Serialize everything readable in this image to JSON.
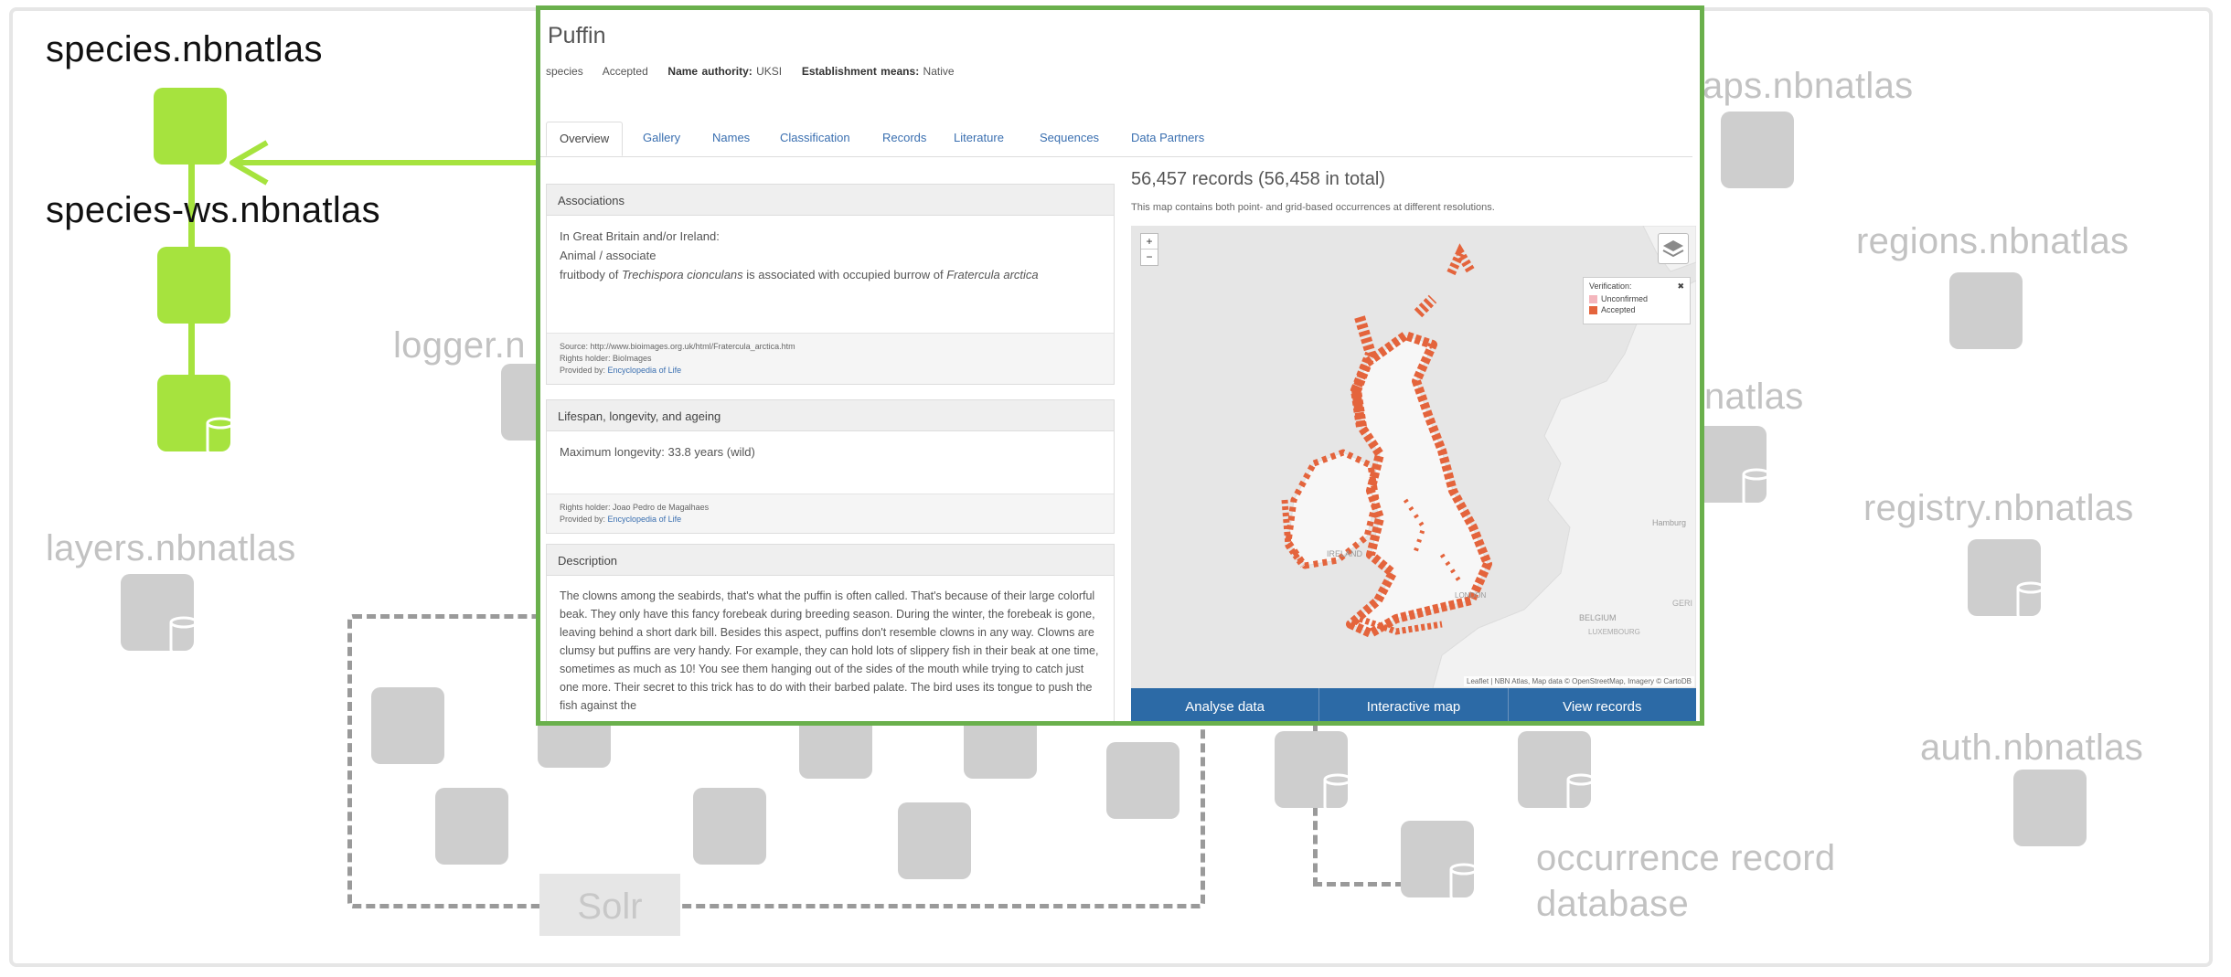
{
  "diagram": {
    "labels": {
      "species": "species.nbnatlas",
      "species_ws": "species-ws.nbnatlas",
      "logger": "logger.n",
      "layers": "layers.nbnatlas",
      "maps": "aps.nbnatlas",
      "regions": "regions.nbnatlas",
      "natlas": "natlas",
      "registry": "registry.nbnatlas",
      "auth": "auth.nbnatlas",
      "occurrence_line1": "occurrence record",
      "occurrence_line2": "database",
      "solr": "Solr"
    },
    "colors": {
      "highlight": "#a6e33e",
      "node": "#cecece",
      "panel_border": "#6ab04c"
    }
  },
  "species_page": {
    "title": "Puffin",
    "meta": {
      "rank": "species",
      "status": "Accepted",
      "name_authority_label": "Name authority:",
      "name_authority": "UKSI",
      "establishment_label": "Establishment means:",
      "establishment": "Native"
    },
    "tabs": [
      "Overview",
      "Gallery",
      "Names",
      "Classification",
      "Records",
      "Literature",
      "Sequences",
      "Data Partners"
    ],
    "associations": {
      "heading": "Associations",
      "line1": "In Great Britain and/or Ireland:",
      "line2": "Animal / associate",
      "line3_a": "fruitbody of ",
      "line3_species1": "Trechispora cionculans",
      "line3_b": " is associated with occupied burrow of ",
      "line3_species2": "Fratercula arctica",
      "source": "Source: http://www.bioimages.org.uk/html/Fratercula_arctica.htm",
      "rights": "Rights holder: BioImages",
      "provided_label": "Provided by: ",
      "provided": "Encyclopedia of Life"
    },
    "lifespan": {
      "heading": "Lifespan, longevity, and ageing",
      "text": "Maximum longevity: 33.8 years (wild)",
      "rights": "Rights holder: Joao Pedro de Magalhaes",
      "provided_label": "Provided by: ",
      "provided": "Encyclopedia of Life"
    },
    "description": {
      "heading": "Description",
      "text": "The clowns among the seabirds, that's what the puffin is often called. That's because of their large colorful beak. They only have this fancy forebeak during breeding season. During the winter, the forebeak is gone, leaving behind a short dark bill. Besides this aspect, puffins don't resemble clowns in any way. Clowns are clumsy but puffins are very handy. For example, they can hold lots of slippery fish in their beak at one time, sometimes as much as 10! You see them hanging out of the sides of the mouth while trying to catch just one more. Their secret to this trick has to do with their barbed palate. The bird uses its tongue to push the fish against the"
    },
    "records": {
      "heading": "56,457 records (56,458 in total)",
      "subtitle": "This map contains both point- and grid-based occurrences at different resolutions."
    },
    "map": {
      "zoom_in": "+",
      "zoom_out": "−",
      "legend_title": "Verification:",
      "legend_close": "✖",
      "legend_items": [
        {
          "label": "Unconfirmed",
          "color": "#f4b6bd"
        },
        {
          "label": "Accepted",
          "color": "#e4643c"
        }
      ],
      "labels": {
        "ireland": "IRELAND",
        "london": "LONDON",
        "belgium": "BELGIUM",
        "luxembourg": "LUXEMBOURG",
        "hamburg": "Hamburg",
        "germany": "GERI"
      },
      "attribution": "Leaflet | NBN Atlas, Map data © OpenStreetMap, Imagery © CartoDB",
      "accent": "#e4643c",
      "layers_icon": "layers-icon"
    },
    "buttons": {
      "analyse": "Analyse data",
      "interactive": "Interactive map",
      "view": "View records"
    }
  }
}
